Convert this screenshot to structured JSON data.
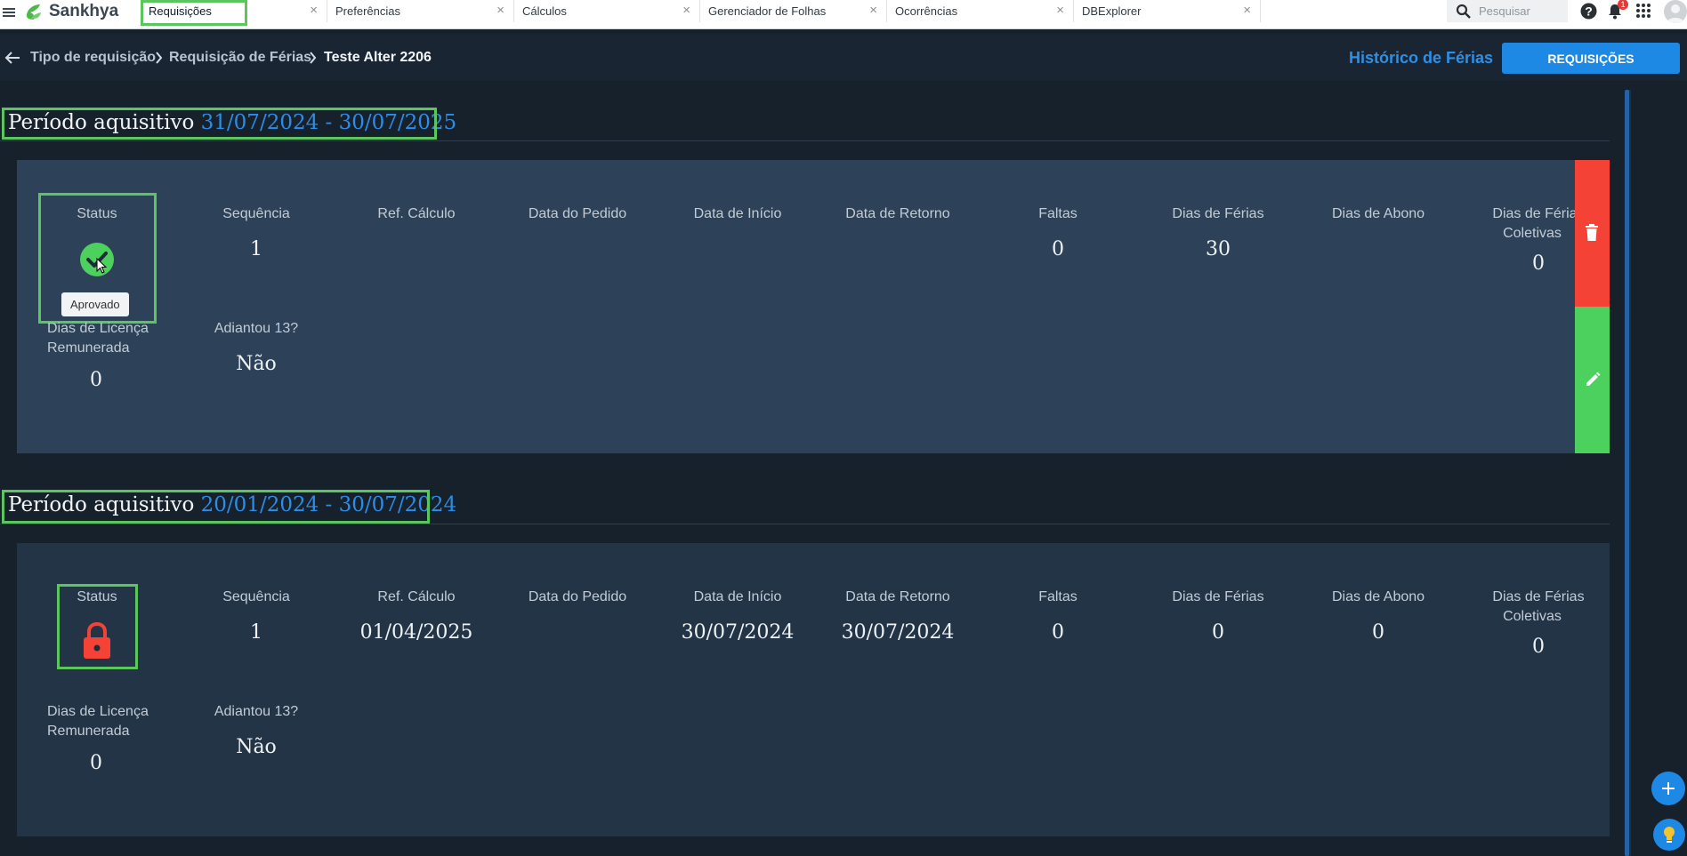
{
  "app": {
    "brand": "Sankhya"
  },
  "tabs": [
    {
      "label": "Requisições",
      "active": true
    },
    {
      "label": "Preferências"
    },
    {
      "label": "Cálculos"
    },
    {
      "label": "Gerenciador de Folhas"
    },
    {
      "label": "Ocorrências"
    },
    {
      "label": "DBExplorer"
    }
  ],
  "tab_close_glyph": "×",
  "search": {
    "placeholder": "Pesquisar"
  },
  "notifications": {
    "count": "1"
  },
  "breadcrumb": {
    "items": [
      "Tipo de requisição",
      "Requisição de Férias",
      "Teste Alter 2206"
    ]
  },
  "header": {
    "history_link": "Histórico de Férias",
    "requests_button": "REQUISIÇÕES"
  },
  "labels": {
    "period": "Período aquisitivo",
    "status": "Status",
    "sequencia": "Sequência",
    "ref_calculo": "Ref. Cálculo",
    "data_pedido": "Data do Pedido",
    "data_inicio": "Data de Início",
    "data_retorno": "Data de Retorno",
    "faltas": "Faltas",
    "dias_ferias": "Dias de Férias",
    "dias_abono": "Dias de Abono",
    "dias_ferias_coletivas_1": "Dias de Férias",
    "dias_ferias_coletivas_2": "Coletivas",
    "dias_licenca_1": "Dias de Licença",
    "dias_licenca_2": "Remunerada",
    "adiantou13": "Adiantou 13?"
  },
  "periods": [
    {
      "range": "31/07/2024 - 30/07/2025",
      "status": "Aprovado",
      "status_icon": "check-circle-icon",
      "status_color": "#4cd05e",
      "sequencia": "1",
      "ref_calculo": "",
      "data_pedido": "",
      "data_inicio": "",
      "data_retorno": "",
      "faltas": "0",
      "dias_ferias": "30",
      "dias_abono": "",
      "dias_ferias_coletivas": "0",
      "dias_licenca": "0",
      "adiantou13": "Não"
    },
    {
      "range": "20/01/2024 - 30/07/2024",
      "status_icon": "lock-icon",
      "status_color": "#f44336",
      "sequencia": "1",
      "ref_calculo": "01/04/2025",
      "data_pedido": "",
      "data_inicio": "30/07/2024",
      "data_retorno": "30/07/2024",
      "faltas": "0",
      "dias_ferias": "0",
      "dias_abono": "0",
      "dias_ferias_coletivas": "0",
      "dias_licenca": "0",
      "adiantou13": "Não"
    }
  ],
  "colors": {
    "accent": "#1e88e5",
    "highlight": "#5bc65e",
    "delete": "#f44336",
    "edit": "#4cd05e"
  }
}
